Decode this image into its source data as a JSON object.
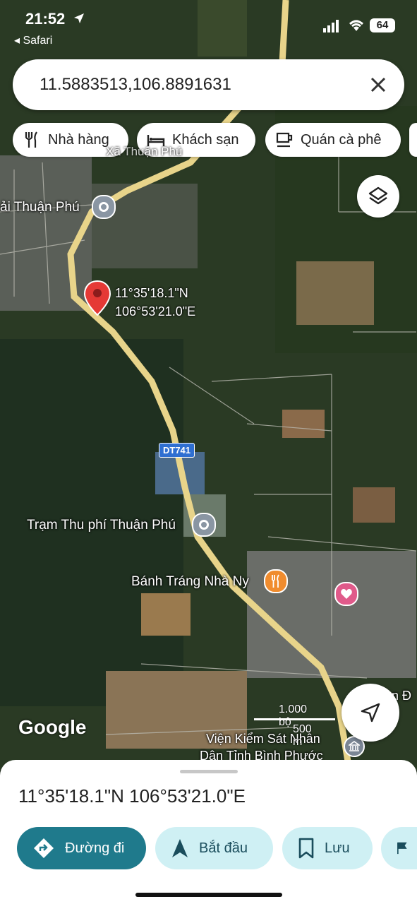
{
  "status_bar": {
    "time": "21:52",
    "back_app": "◂ Safari",
    "battery": "64",
    "location_icon": "location-arrow-icon"
  },
  "search": {
    "value": "11.5883513,106.8891631",
    "clear_icon": "close-icon"
  },
  "chips": [
    {
      "label": "Nhà hàng",
      "icon": "fork-knife-icon"
    },
    {
      "label": "Khách sạn",
      "icon": "bed-icon"
    },
    {
      "label": "Quán cà phê",
      "icon": "coffee-cup-icon"
    }
  ],
  "map": {
    "pin_label_lat": "11°35'18.1\"N",
    "pin_label_lon": "106°53'21.0\"E",
    "labels": {
      "thuan_phu": "ải Thuận Phú",
      "tram_thu_phi": "Trạm Thu phí Thuận Phú",
      "banh_trang": "Bánh Tráng Nhà Ny",
      "vien_kiem_sat_1": "Viện Kiểm Sát Nhân",
      "vien_kiem_sat_2": "Dân Tỉnh Bình Phước",
      "edge_label": "n Đ",
      "partial_top": "Xã Thuận Phú"
    },
    "route_shield": "DT741",
    "google_logo": "Google",
    "scale_imperial": "1.000 bộ",
    "scale_metric": "500 m"
  },
  "sheet": {
    "coordinates": "11°35'18.1\"N 106°53'21.0\"E",
    "buttons": [
      {
        "label": "Đường đi",
        "icon": "directions-icon"
      },
      {
        "label": "Bắt đầu",
        "icon": "navigation-arrow-icon"
      },
      {
        "label": "Lưu",
        "icon": "bookmark-icon"
      }
    ]
  },
  "colors": {
    "primary": "#1f7a8c",
    "secondary": "#cff0f4",
    "pin": "#e53935",
    "road": "#e8d48a"
  }
}
